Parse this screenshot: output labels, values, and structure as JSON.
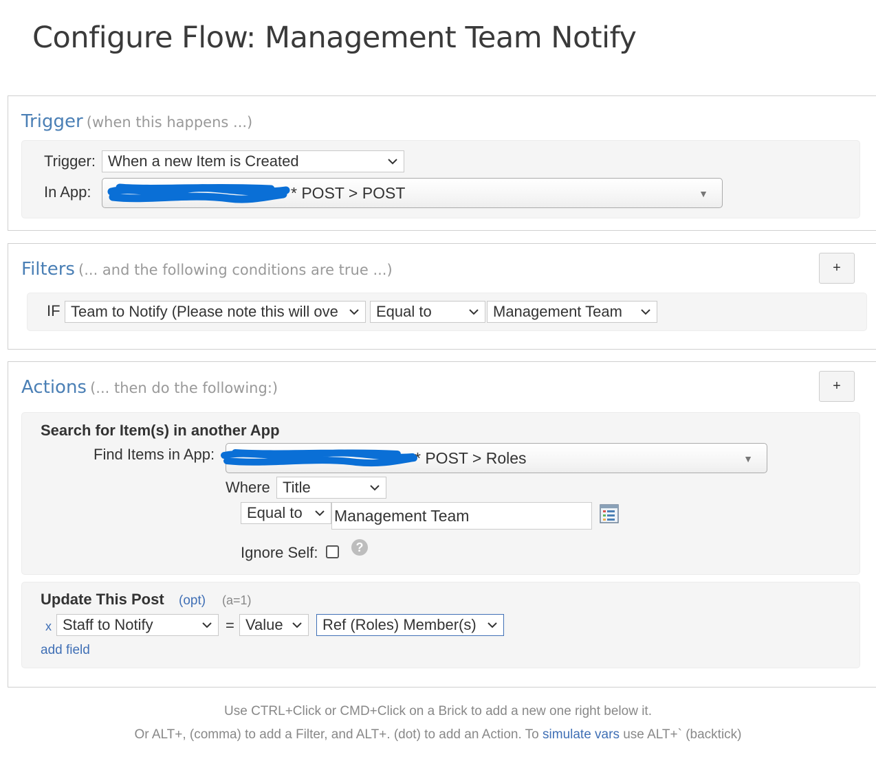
{
  "page": {
    "title": "Configure Flow: Management Team Notify"
  },
  "trigger": {
    "heading": "Trigger",
    "subheading": "(when this happens ...)",
    "trigger_label": "Trigger:",
    "trigger_value": "When a new Item is Created",
    "app_label": "In App:",
    "app_value": "* POST > POST"
  },
  "filters": {
    "heading": "Filters",
    "subheading": "(... and the following conditions are true ...)",
    "add_label": "+",
    "if_label": "IF",
    "field_value": "Team to Notify (Please note this will ove",
    "operator_value": "Equal to",
    "value_value": "Management Team"
  },
  "actions": {
    "heading": "Actions",
    "subheading": "(... then do the following:)",
    "add_label": "+",
    "search": {
      "title": "Search for Item(s) in another App",
      "find_label": "Find Items in App:",
      "app_value": "* POST > Roles",
      "where_label": "Where",
      "where_field": "Title",
      "operator_value": "Equal to",
      "input_value": "Management Team",
      "ignore_self_label": "Ignore Self:",
      "help_glyph": "?"
    },
    "update": {
      "title": "Update This Post",
      "opt_label": "(opt)",
      "counter": "(a=1)",
      "remove_glyph": "x",
      "field_value": "Staff to Notify",
      "equals": "=",
      "mode_value": "Value",
      "ref_value": "Ref (Roles) Member(s)",
      "add_field_label": "add field"
    }
  },
  "footer": {
    "line1": "Use CTRL+Click or CMD+Click on a Brick to add a new one right below it.",
    "line2_prefix": "Or ALT+, (comma) to add a Filter, and ALT+. (dot) to add an Action. To ",
    "line2_link": "simulate vars",
    "line2_suffix": " use ALT+` (backtick)"
  },
  "icons": {
    "chevron": "chevron-down-icon",
    "triangle": "caret-down-icon",
    "calc": "expression-editor-icon",
    "help": "help-icon"
  },
  "colors": {
    "heading_blue": "#4a7fb5",
    "link_blue": "#3f6fb5",
    "scribble_blue": "#0a6fd6",
    "ref_border": "#3f6fb5"
  }
}
